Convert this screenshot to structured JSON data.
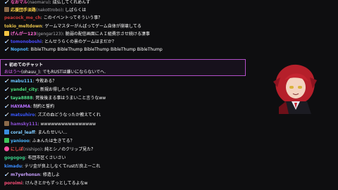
{
  "colors": {
    "background": "#0e0e10",
    "first_chat_border": "#b24fc7"
  },
  "messages_top": [
    {
      "badge": "sword",
      "name": "なおマル",
      "paren": "(naomaru)",
      "sep": ": ",
      "text": "成仏してくれめんす",
      "color": "#ff5cbf"
    },
    {
      "badge": "img",
      "name": "応援団手淡路",
      "paren": "(nakottrobo)",
      "sep": ": ",
      "text": "しばらくは",
      "color": "#ffd54a"
    },
    {
      "badge": "none",
      "name": "peacock_me_ch",
      "paren": "",
      "sep": ": ",
      "text": "このイベントってそういう事？",
      "color": "#d03a3a"
    },
    {
      "badge": "none",
      "name": "tokio_meltdown",
      "paren": "",
      "sep": ": ",
      "text": "ゲームマスターがんばってゲーム自体が崩壊してる",
      "color": "#e9c44a"
    },
    {
      "badge": "crown",
      "name": "げんがー123",
      "paren": "(gengar123)",
      "sep": ": ",
      "text": "脆弱の配信画面にＡＩ組費示させ続ける凄事",
      "color": "#ff6ad5"
    },
    {
      "badge": "sword",
      "name": "tomonoboshi",
      "paren": "",
      "sep": ": ",
      "text": "とんせうらくの景のゲームはまだか？",
      "color": "#4a4aff"
    },
    {
      "badge": "sword",
      "name": "Nopnot",
      "paren": "",
      "sep": ": ",
      "text": "BibleThump BibleThump BibleThump BibleThump BibleThump",
      "color": "#4fb3ff"
    }
  ],
  "first_chat": {
    "title": "初めてのチャット",
    "name": "おはう〜",
    "paren": "(ohauu_)",
    "sep": ": ",
    "text": "でもRUSTは嫌いにならないでへ.",
    "color": "#e36bff"
  },
  "messages_bottom": [
    {
      "badge": "sword",
      "name": "mabu111",
      "paren": "",
      "sep": ": ",
      "text": "今敗ある？",
      "color": "#6ac3ff"
    },
    {
      "badge": "sword",
      "name": "yandel_city",
      "paren": "",
      "sep": ": ",
      "text": "新規お得したイベント",
      "color": "#48e07a"
    },
    {
      "badge": "sword",
      "name": "taya8888",
      "paren": "",
      "sep": ": ",
      "text": "死後後まる事はうまいこと言うなww",
      "color": "#4fe08a"
    },
    {
      "badge": "sword",
      "name": "HAYAMA",
      "paren": "",
      "sep": ": ",
      "text": "制約と誓約",
      "color": "#b870ff"
    },
    {
      "badge": "sword",
      "name": "matsuhiro",
      "paren": "",
      "sep": ": ",
      "text": "ズズの血どうなったか教えてくれ",
      "color": "#3a58ff"
    },
    {
      "badge": "img",
      "name": "hamsky111",
      "paren": "",
      "sep": ": ",
      "text": "wwwwwwwwwwwwwwww",
      "color": "#8a4fd0"
    },
    {
      "badge": "blue",
      "name": "coral_leaff",
      "paren": "",
      "sep": ": ",
      "text": "まんたせいい...",
      "color": "#7ecbff"
    },
    {
      "badge": "green",
      "name": "yaniooo",
      "paren": "",
      "sep": ": ",
      "text": "ふぁんたは生きてる？",
      "color": "#4ab6ff"
    },
    {
      "badge": "heart",
      "name": "にしぽ",
      "paren": "(nishipo)",
      "sep": ": ",
      "text": "純とシノのクリップ見た？",
      "color": "#ff5555"
    },
    {
      "badge": "none",
      "name": "gogogog",
      "paren": "",
      "sep": ": ",
      "text": "布団市区くさいさい",
      "color": "#3bd28a"
    },
    {
      "badge": "none",
      "name": "kimadu",
      "paren": "",
      "sep": ": ",
      "text": "テリ金が良上しなくてrustだ良上ーこれ",
      "color": "#3a8dff"
    },
    {
      "badge": "sword",
      "name": "m7yerhonsn",
      "paren": "",
      "sep": ": ",
      "text": "修造しよ",
      "color": "#c8a0ff"
    },
    {
      "badge": "none",
      "name": "poroimi",
      "paren": "",
      "sep": ": ",
      "text": "けんきとかもずっとしてるよなw",
      "color": "#ff4f7a"
    }
  ]
}
